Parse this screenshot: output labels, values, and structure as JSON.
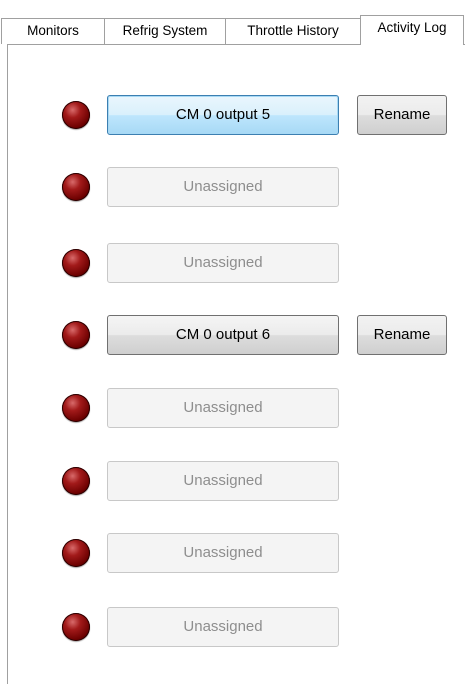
{
  "tabs": [
    {
      "label": "Monitors"
    },
    {
      "label": "Refrig System"
    },
    {
      "label": "Throttle History"
    },
    {
      "label": "Activity Log"
    }
  ],
  "led_color": "#8b0000",
  "outputs": [
    {
      "label": "CM 0 output 5",
      "state": "focused",
      "rename_label": "Rename"
    },
    {
      "label": "Unassigned",
      "state": "unassigned"
    },
    {
      "label": "Unassigned",
      "state": "unassigned"
    },
    {
      "label": "CM 0 output 6",
      "state": "assigned",
      "rename_label": "Rename"
    },
    {
      "label": "Unassigned",
      "state": "unassigned"
    },
    {
      "label": "Unassigned",
      "state": "unassigned"
    },
    {
      "label": "Unassigned",
      "state": "unassigned"
    },
    {
      "label": "Unassigned",
      "state": "unassigned"
    }
  ]
}
